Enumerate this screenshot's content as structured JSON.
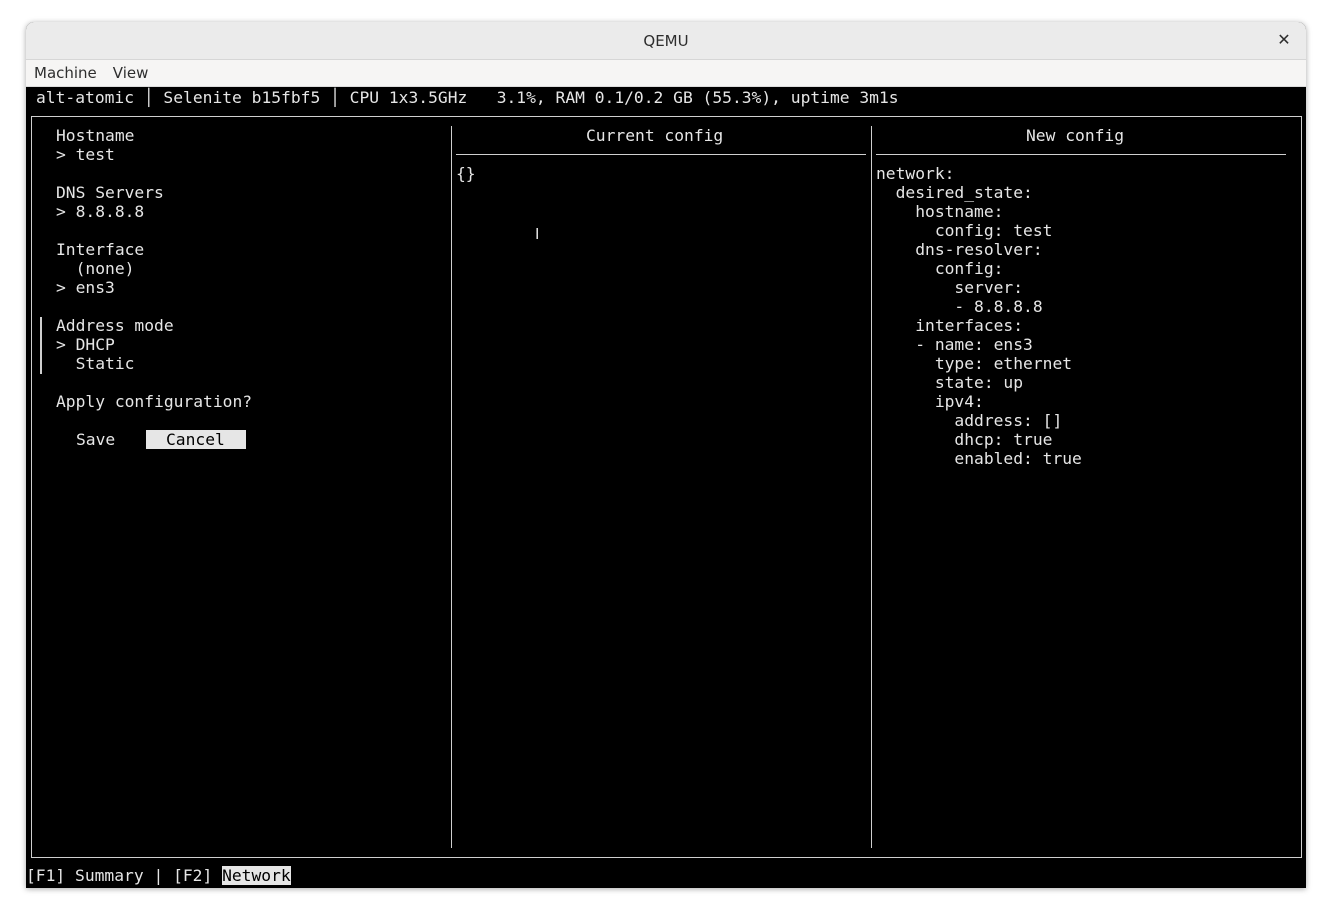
{
  "window": {
    "title": "QEMU",
    "close_icon": "close-icon"
  },
  "menubar": {
    "items": [
      "Machine",
      "View"
    ]
  },
  "statusbar": {
    "text": "alt-atomic │ Selenite b15fbf5 │ CPU 1x3.5GHz   3.1%, RAM 0.1/0.2 GB (55.3%), uptime 3m1s"
  },
  "form": {
    "hostname_label": "Hostname",
    "hostname_value": "> test",
    "dns_label": "DNS Servers",
    "dns_value": "> 8.8.8.8",
    "interface_label": "Interface",
    "interface_options": [
      "  (none)",
      "> ens3"
    ],
    "address_mode_label": "Address mode",
    "address_mode_options": [
      "> DHCP",
      "  Static"
    ],
    "apply_label": "Apply configuration?",
    "save_label": "Save",
    "cancel_label": "Cancel"
  },
  "current_config": {
    "header": "Current config",
    "lines": [
      "{}"
    ],
    "cursor": "I"
  },
  "new_config": {
    "header": "New config",
    "lines": [
      "network:",
      "  desired_state:",
      "    hostname:",
      "      config: test",
      "    dns-resolver:",
      "      config:",
      "        server:",
      "        - 8.8.8.8",
      "    interfaces:",
      "    - name: ens3",
      "      type: ethernet",
      "      state: up",
      "      ipv4:",
      "        address: []",
      "        dhcp: true",
      "        enabled: true"
    ]
  },
  "footer": {
    "f1": "[F1] Summary",
    "sep": " | ",
    "f2_key": "[F2] ",
    "f2_label": "Network"
  }
}
